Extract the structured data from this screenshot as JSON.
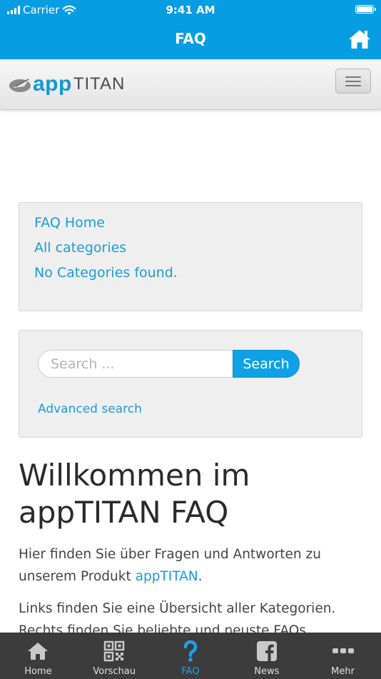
{
  "status_bar": {
    "carrier": "Carrier",
    "time": "9:41 AM"
  },
  "nav_bar": {
    "title": "FAQ",
    "home_icon": "home-icon"
  },
  "site_header": {
    "logo_app": "app",
    "logo_titan": "TITAN",
    "menu_icon": "hamburger-icon"
  },
  "faq_nav": {
    "links": [
      "FAQ Home",
      "All categories",
      "No Categories found."
    ]
  },
  "search": {
    "placeholder": "Search ...",
    "value": "",
    "button_label": "Search",
    "advanced_label": "Advanced search"
  },
  "main": {
    "heading": "Willkommen im appTITAN FAQ",
    "paragraph1_before": "Hier finden Sie über Fragen und Antworten zu unserem Produkt ",
    "paragraph1_link": "appTITAN",
    "paragraph1_after": ".",
    "paragraph2": "Links finden Sie eine Übersicht aller Kategorien. Rechts finden Sie beliebte und neuste FAQs."
  },
  "tab_bar": {
    "active": "FAQ",
    "tabs": [
      {
        "label": "Home",
        "icon": "home-icon"
      },
      {
        "label": "Vorschau",
        "icon": "qr-code-icon"
      },
      {
        "label": "FAQ",
        "icon": "question-mark-icon"
      },
      {
        "label": "News",
        "icon": "facebook-icon"
      },
      {
        "label": "Mehr",
        "icon": "more-dots-icon"
      }
    ]
  },
  "colors": {
    "accent": "#069de3",
    "link": "#1a9bd7",
    "tab_bar": "#3c3c3c",
    "active_tab": "#1aa3e8"
  }
}
